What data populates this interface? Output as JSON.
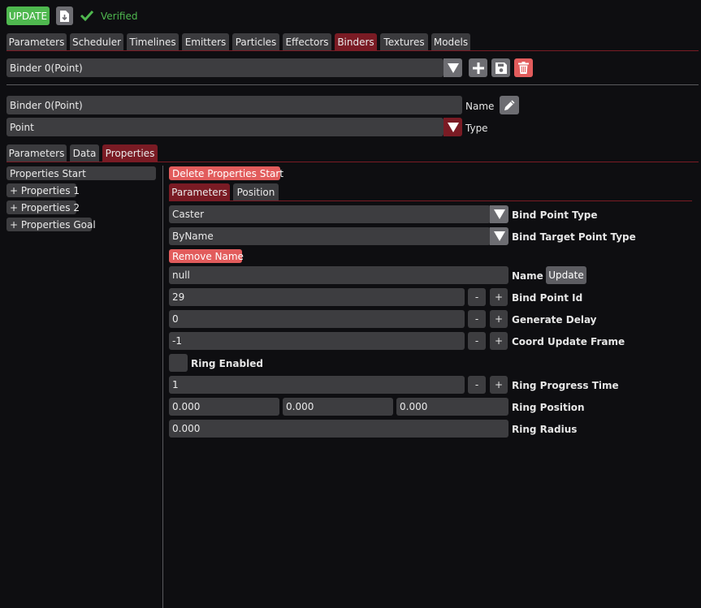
{
  "toolbar": {
    "update_label": "UPDATE",
    "save_icon": "file-download-icon",
    "verified_icon": "checkmark-icon",
    "verified_text": "Verified",
    "verified_color": "#4fb84f"
  },
  "main_tabs": [
    "Parameters",
    "Scheduler",
    "Timelines",
    "Emitters",
    "Particles",
    "Effectors",
    "Binders",
    "Textures",
    "Models"
  ],
  "main_tabs_active": "Binders",
  "binder_select": {
    "value": "Binder 0(Point)",
    "add_icon": "plus-icon",
    "save_icon": "save-icon",
    "delete_icon": "trash-icon"
  },
  "binder": {
    "name_value": "Binder 0(Point)",
    "name_label": "Name",
    "edit_icon": "pencil-icon",
    "type_value": "Point",
    "type_label": "Type"
  },
  "sub_tabs": [
    "Parameters",
    "Data",
    "Properties"
  ],
  "sub_tabs_active": "Properties",
  "tree": {
    "selected": "Properties Start",
    "items": [
      "+ Properties 1",
      "+ Properties 2",
      "+ Properties Goal"
    ]
  },
  "props": {
    "delete_label": "Delete Properties Start",
    "tabs": [
      "Parameters",
      "Position"
    ],
    "tabs_active": "Parameters",
    "bind_point_type": {
      "value": "Caster",
      "label": "Bind Point Type"
    },
    "bind_target_point_type": {
      "value": "ByName",
      "label": "Bind Target Point Type"
    },
    "remove_name_label": "Remove Name",
    "name": {
      "value": "null",
      "label": "Name",
      "update_label": "Update"
    },
    "bind_point_id": {
      "value": "29",
      "label": "Bind Point Id"
    },
    "generate_delay": {
      "value": "0",
      "label": "Generate Delay"
    },
    "coord_update_frame": {
      "value": "-1",
      "label": "Coord Update Frame"
    },
    "ring_enabled": {
      "label": "Ring Enabled",
      "checked": false
    },
    "ring_progress_time": {
      "value": "1",
      "label": "Ring Progress Time"
    },
    "ring_position": {
      "x": "0.000",
      "y": "0.000",
      "z": "0.000",
      "label": "Ring Position"
    },
    "ring_radius": {
      "value": "0.000",
      "label": "Ring Radius"
    },
    "minus": "-",
    "plus": "+"
  },
  "colors": {
    "accent_red": "#7a1b24",
    "button_red": "#e25c5c",
    "field_bg": "#3d3d40",
    "background": "#0e0e11"
  }
}
